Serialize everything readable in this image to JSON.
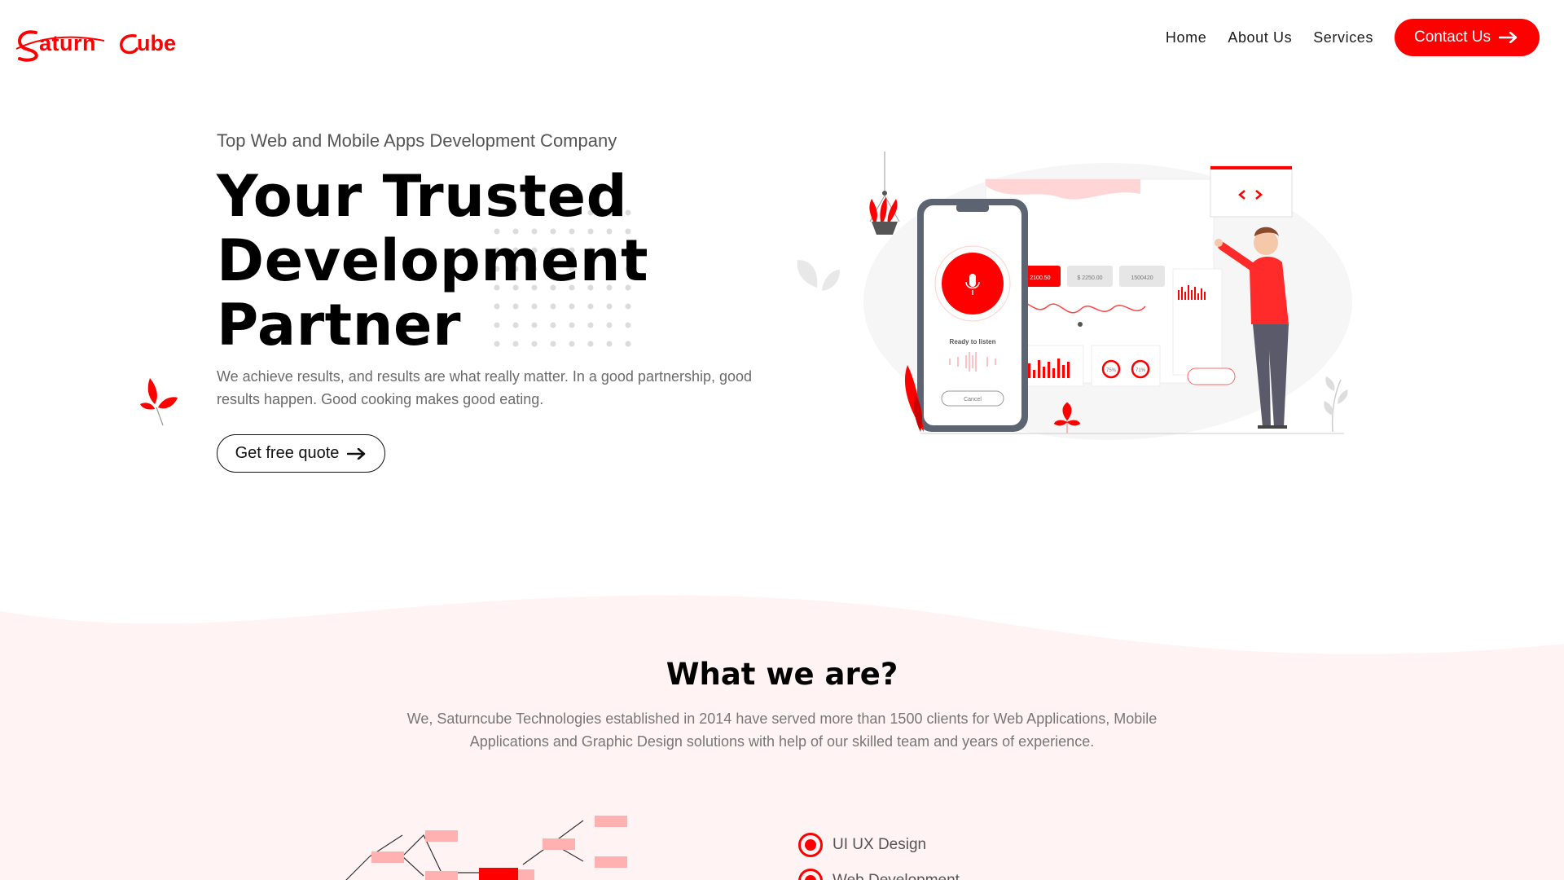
{
  "brand": {
    "logo_text": "SaturnCube",
    "accent": "#ff0000"
  },
  "nav": {
    "items": [
      "Home",
      "About Us",
      "Services"
    ],
    "contact_label": "Contact Us"
  },
  "hero": {
    "subtitle": "Top Web and Mobile Apps Development Company",
    "title_line1": "Your Trusted",
    "title_line2": "Development",
    "title_line3": "Partner",
    "description": "We achieve results, and results are what really matter. In a good partnership, good results happen. Good cooking makes good eating.",
    "cta_label": "Get free quote"
  },
  "illustration": {
    "ready_label": "Ready to listen",
    "cancel_label": "Cancel",
    "stat1": "$ 2100.50",
    "stat2": "$ 2250.00",
    "stat3": "1500420",
    "gauge1": "75%",
    "gauge2": "71%"
  },
  "about": {
    "title": "What we are?",
    "description": "We, Saturncube Technologies established in 2014 have served more than 1500 clients for Web Applications, Mobile Applications and Graphic Design solutions with help of our skilled team and years of experience."
  },
  "services": {
    "items": [
      "UI UX Design",
      "Web Development"
    ]
  }
}
